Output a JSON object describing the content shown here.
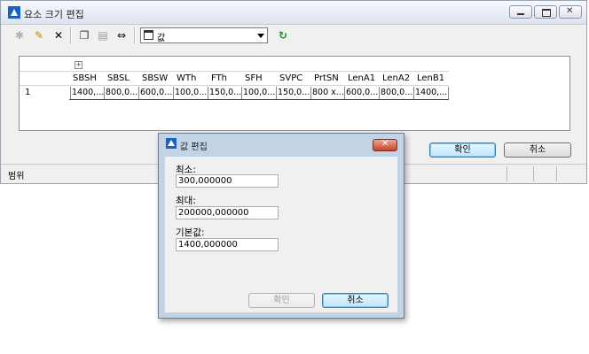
{
  "main_window": {
    "title": "요소 크기 편집",
    "toolbar": {
      "combo_value": "값"
    },
    "grid": {
      "columns": [
        "SBSH",
        "SBSL",
        "SBSW",
        "WTh",
        "FTh",
        "SFH",
        "SVPC",
        "PrtSN",
        "LenA1",
        "LenA2",
        "LenB1"
      ],
      "rows": [
        {
          "index": "1",
          "cells": [
            "1400,...",
            "800,0...",
            "600,0...",
            "100,0...",
            "150,0...",
            "100,0...",
            "150,0...",
            "800 x...",
            "600,0...",
            "800,0...",
            "1400,..."
          ]
        }
      ]
    },
    "ok_label": "확인",
    "cancel_label": "취소",
    "status_text": "범위"
  },
  "dialog": {
    "title": "값 편집",
    "min_label": "최소:",
    "min_value": "300,000000",
    "max_label": "최대:",
    "max_value": "200000,000000",
    "default_label": "기본값:",
    "default_value": "1400,000000",
    "ok_label": "확인",
    "cancel_label": "취소"
  }
}
